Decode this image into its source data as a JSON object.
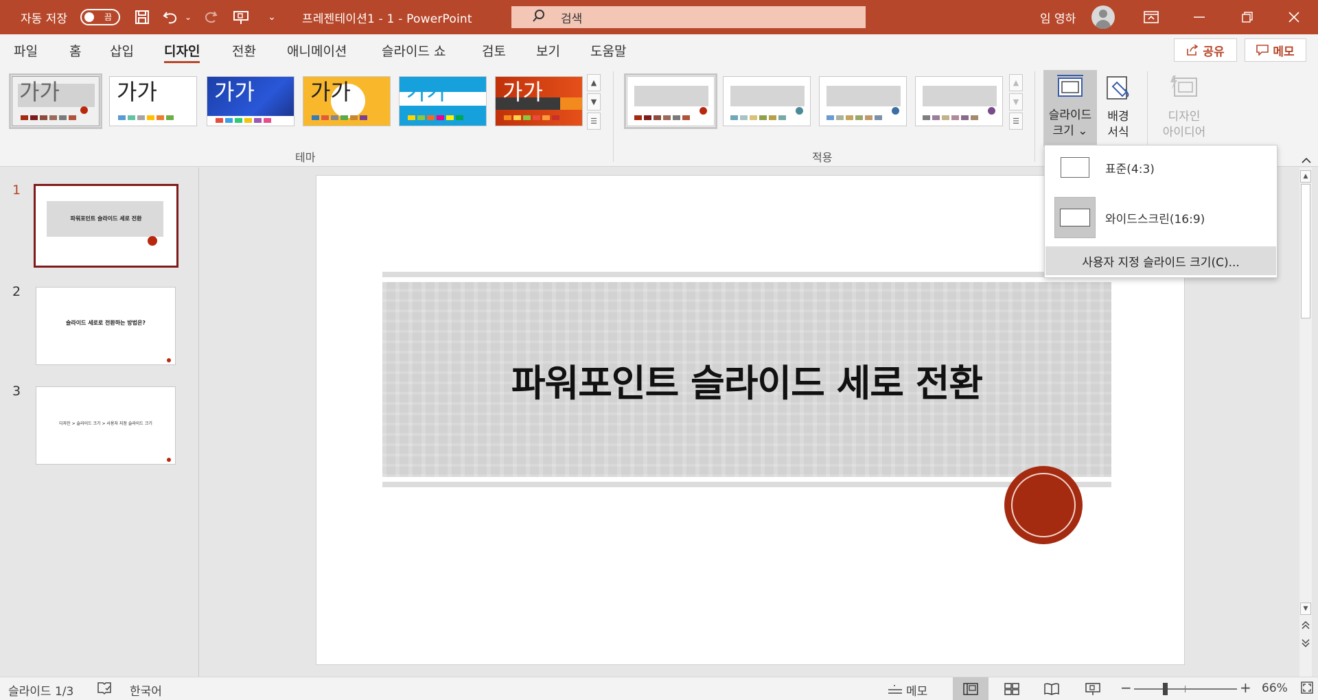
{
  "titlebar": {
    "autosave_label": "자동 저장",
    "autosave_state": "끔",
    "document_title": "프레젠테이션1  -  1  -  PowerPoint",
    "search_placeholder": "검색",
    "user_name": "임 영하"
  },
  "menu": {
    "tabs": [
      "파일",
      "홈",
      "삽입",
      "디자인",
      "전환",
      "애니메이션",
      "슬라이드 쇼",
      "검토",
      "보기",
      "도움말"
    ],
    "active_tab": "디자인",
    "share_label": "공유",
    "memo_label": "메모"
  },
  "ribbon": {
    "themes_group_label": "테마",
    "variants_group_label": "적용",
    "theme_sample_text": "가가",
    "slide_size_label_line1": "슬라이드",
    "slide_size_label_line2": "크기",
    "bg_format_label_line1": "배경",
    "bg_format_label_line2": "서식",
    "design_ideas_label_line1": "디자인",
    "design_ideas_label_line2": "아이디어"
  },
  "dropdown": {
    "standard_label": "표준(4:3)",
    "widescreen_label": "와이드스크린(16:9)",
    "custom_label": "사용자 지정 슬라이드 크기(C)..."
  },
  "slides": [
    {
      "number": "1",
      "text": "파워포인트 슬라이드 세로 전환"
    },
    {
      "number": "2",
      "text": "슬라이드 세로로 전환하는 방법은?"
    },
    {
      "number": "3",
      "text": "디자인 > 슬라이드 크기 > 사용자 지정 슬라이드 크기"
    }
  ],
  "current_slide": {
    "title": "파워포인트 슬라이드 세로 전환"
  },
  "statusbar": {
    "slide_counter": "슬라이드 1/3",
    "language": "한국어",
    "notes_label": "메모",
    "zoom_level": "66%"
  },
  "colors": {
    "accent": "#b7472a",
    "title_bar": "#b7472a",
    "stamp": "#a42a10"
  }
}
